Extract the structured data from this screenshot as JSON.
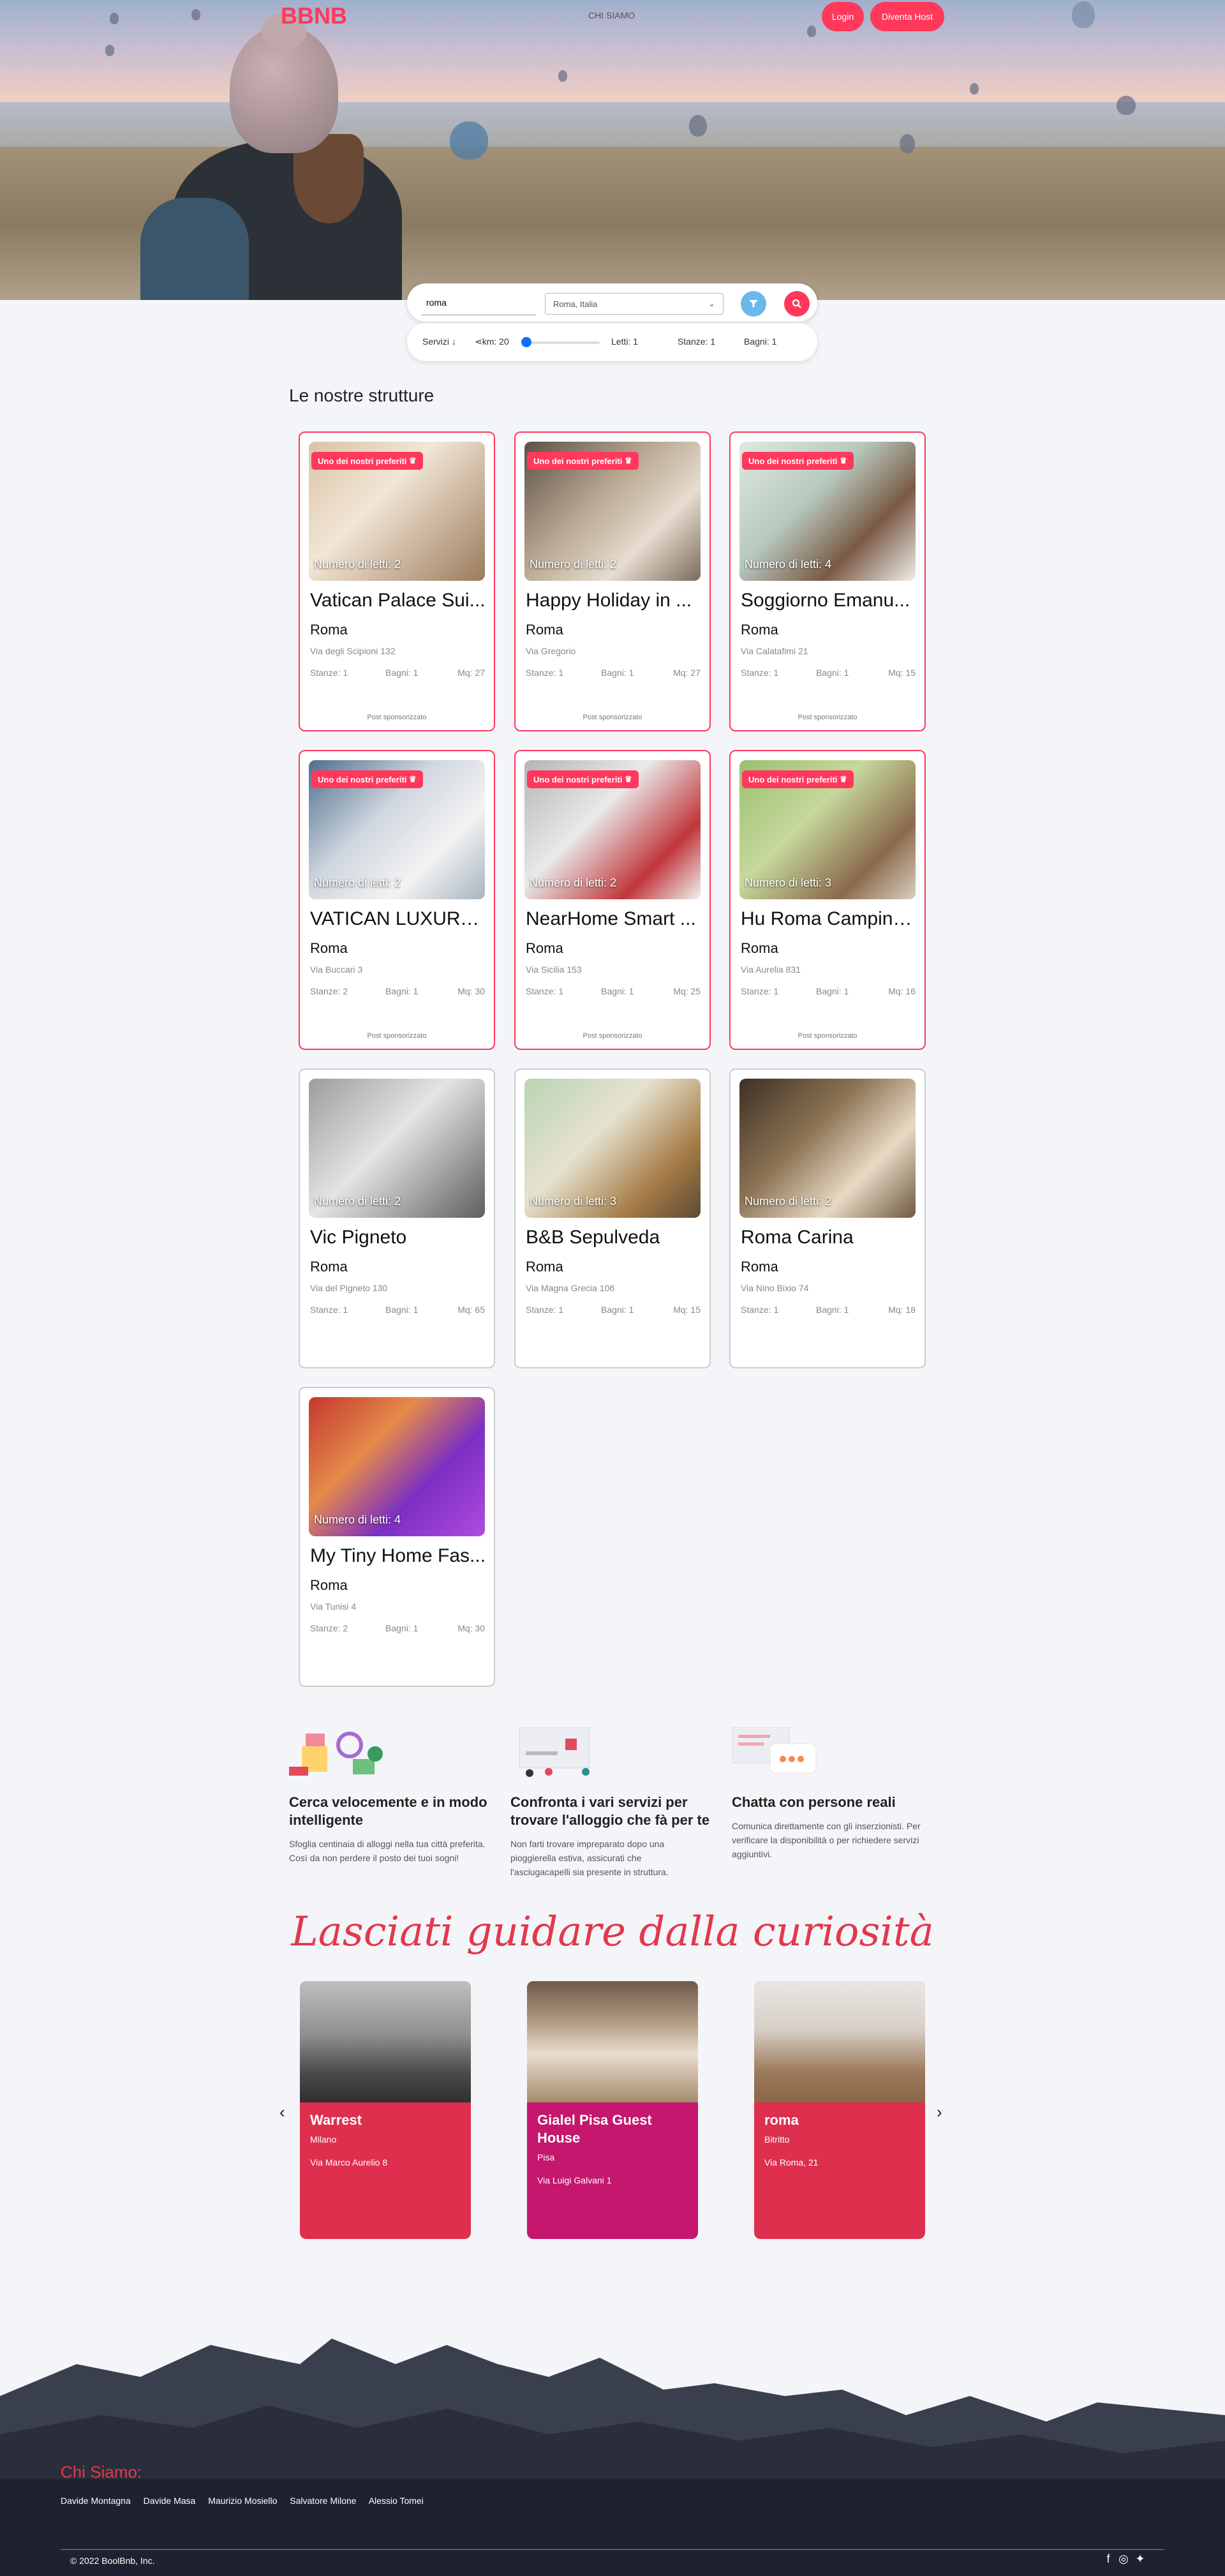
{
  "nav": {
    "logo": "BBNB",
    "link": "CHI SIAMO",
    "login": "Login",
    "host": "Diventa Host"
  },
  "search": {
    "value": "roma",
    "location": "Roma, Italia"
  },
  "filters": {
    "services": "Servizi",
    "km": "km: 20",
    "beds": "Letti: 1",
    "rooms": "Stanze: 1",
    "baths": "Bagni: 1",
    "km_value": 20
  },
  "section_title": "Le nostre strutture",
  "badge_label": "Uno dei nostri preferiti",
  "sponsored_label": "Post sponsorizzato",
  "cards": [
    {
      "name": "Vatican Palace Sui...",
      "beds": "Numero di letti: 2",
      "city": "Roma",
      "address": "Via degli Scipioni 132",
      "rooms": "Stanze: 1",
      "baths": "Bagni: 1",
      "mq": "Mq: 27"
    },
    {
      "name": "Happy Holiday in ...",
      "beds": "Numero di letti: 2",
      "city": "Roma",
      "address": "Via Gregorio",
      "rooms": "Stanze: 1",
      "baths": "Bagni: 1",
      "mq": "Mq: 27"
    },
    {
      "name": "Soggiorno Emanu...",
      "beds": "Numero di letti: 4",
      "city": "Roma",
      "address": "Via Calatafimi 21",
      "rooms": "Stanze: 1",
      "baths": "Bagni: 1",
      "mq": "Mq: 15"
    },
    {
      "name": "VATICAN LUXURY ...",
      "beds": "Numero di letti: 2",
      "city": "Roma",
      "address": "Via Buccari 3",
      "rooms": "Stanze: 2",
      "baths": "Bagni: 1",
      "mq": "Mq: 30"
    },
    {
      "name": "NearHome Smart ...",
      "beds": "Numero di letti: 2",
      "city": "Roma",
      "address": "Via Sicilia 153",
      "rooms": "Stanze: 1",
      "baths": "Bagni: 1",
      "mq": "Mq: 25"
    },
    {
      "name": "Hu Roma Camping...",
      "beds": "Numero di letti: 3",
      "city": "Roma",
      "address": "Via Aurelia 831",
      "rooms": "Stanze: 1",
      "baths": "Bagni: 1",
      "mq": "Mq: 16"
    },
    {
      "name": "Vic Pigneto",
      "beds": "Numero di letti: 2",
      "city": "Roma",
      "address": "Via del Pigneto 130",
      "rooms": "Stanze: 1",
      "baths": "Bagni: 1",
      "mq": "Mq: 65"
    },
    {
      "name": "B&B Sepulveda",
      "beds": "Numero di letti: 3",
      "city": "Roma",
      "address": "Via Magna Grecia 106",
      "rooms": "Stanze: 1",
      "baths": "Bagni: 1",
      "mq": "Mq: 15"
    },
    {
      "name": "Roma Carina",
      "beds": "Numero di letti: 2",
      "city": "Roma",
      "address": "Via Nino Bixio 74",
      "rooms": "Stanze: 1",
      "baths": "Bagni: 1",
      "mq": "Mq: 18"
    },
    {
      "name": "My Tiny Home Fas...",
      "beds": "Numero di letti: 4",
      "city": "Roma",
      "address": "Via Tunisi 4",
      "rooms": "Stanze: 2",
      "baths": "Bagni: 1",
      "mq": "Mq: 30"
    }
  ],
  "features": [
    {
      "title": "Cerca velocemente e in modo intelligente",
      "text": "Sfoglia centinaia di alloggi nella tua città preferita. Così da non perdere il posto dei tuoi sogni!"
    },
    {
      "title": "Confronta i vari servizi per trovare l'alloggio che fà per te",
      "text": "Non farti trovare impreparato dopo una pioggierella estiva, assicurati che l'asciugacapelli sia presente in struttura."
    },
    {
      "title": "Chatta con persone reali",
      "text": "Comunica direttamente con gli inserzionisti. Per verificare la disponibilità o per richiedere servizi aggiuntivi."
    }
  ],
  "curiosity_title": "Lasciati guidare dalla curiosità",
  "curiosity": [
    {
      "name": "Warrest",
      "city": "Milano",
      "address": "Via Marco Aurelio 8"
    },
    {
      "name": "Gialel Pisa Guest House",
      "city": "Pisa",
      "address": "Via Luigi Galvani 1"
    },
    {
      "name": "roma",
      "city": "Bitritto",
      "address": "Via Roma, 21"
    }
  ],
  "arrows": {
    "prev": "‹",
    "next": "›"
  },
  "footer": {
    "title": "Chi Siamo:",
    "names": [
      "Davide Montagna",
      "Davide Masa",
      "Maurizio Mosiello",
      "Salvatore Milone",
      "Alessio Tomei"
    ],
    "copyright": "© 2022 BoolBnb, Inc."
  },
  "icons": {
    "filter": "filter-icon",
    "search": "search-icon",
    "crown": "crown-icon",
    "share": "share-icon",
    "facebook": "facebook-icon",
    "instagram": "instagram-icon",
    "twitter": "twitter-icon"
  },
  "colors": {
    "brand": "#ff385c",
    "accent": "#e2384d",
    "filter_btn": "#6bb8ea",
    "curiosity_1": "#de2f4e",
    "curiosity_2": "#c4176d",
    "curiosity_3": "#de2f4e"
  }
}
